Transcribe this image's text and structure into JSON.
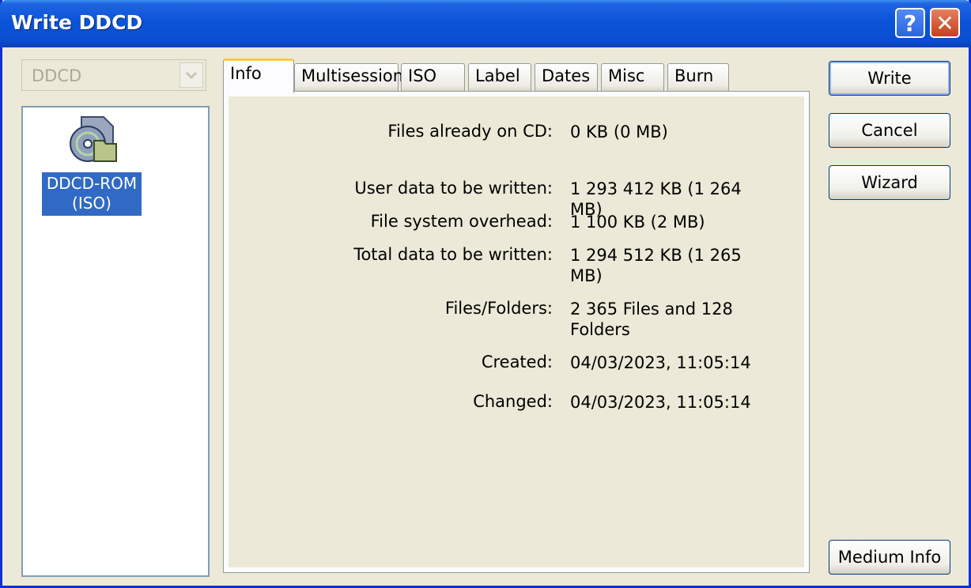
{
  "window": {
    "title": "Write DDCD"
  },
  "titlebar": {
    "help_label": "?",
    "close_label": "✕"
  },
  "drive_select": {
    "value": "DDCD"
  },
  "tree": {
    "item_label": "DDCD-ROM\n(ISO)"
  },
  "tabs": [
    {
      "label": "Info"
    },
    {
      "label": "Multisession"
    },
    {
      "label": "ISO"
    },
    {
      "label": "Label"
    },
    {
      "label": "Dates"
    },
    {
      "label": "Misc"
    },
    {
      "label": "Burn"
    }
  ],
  "info": {
    "files_on_cd_label": "Files already on CD:",
    "files_on_cd_value": "0 KB (0 MB)",
    "user_data_label": "User data to be written:",
    "user_data_value": "1 293 412 KB (1 264 MB)",
    "fs_overhead_label": "File system overhead:",
    "fs_overhead_value": "1 100 KB (2 MB)",
    "total_label": "Total data to be written:",
    "total_value": "1 294 512 KB (1 265 MB)",
    "files_folders_label": "Files/Folders:",
    "files_folders_value": "2 365 Files and 128 Folders",
    "created_label": "Created:",
    "created_value": "04/03/2023, 11:05:14",
    "changed_label": "Changed:",
    "changed_value": "04/03/2023, 11:05:14"
  },
  "buttons": {
    "write": "Write",
    "cancel": "Cancel",
    "wizard": "Wizard",
    "medium_info": "Medium Info"
  },
  "colors": {
    "titlebar": "#0a53d8",
    "selection": "#316ac5",
    "tab_accent": "#ffc83c"
  }
}
